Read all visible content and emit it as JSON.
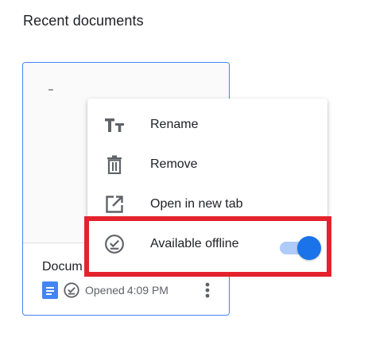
{
  "section": {
    "title": "Recent documents"
  },
  "document": {
    "title": "Docum",
    "meta_prefix": "Opened",
    "meta_time": "4:09 PM"
  },
  "menu": {
    "items": [
      {
        "label": "Rename",
        "icon": "text-format-icon"
      },
      {
        "label": "Remove",
        "icon": "trash-icon"
      },
      {
        "label": "Open in new tab",
        "icon": "open-in-new-icon"
      },
      {
        "label": "Available offline",
        "icon": "offline-check-icon"
      }
    ],
    "offline_toggle": {
      "state": "on"
    }
  },
  "colors": {
    "accent": "#1a73e8",
    "track": "#aecbfa",
    "highlight": "#e5222c",
    "card_border": "#4285f4"
  }
}
